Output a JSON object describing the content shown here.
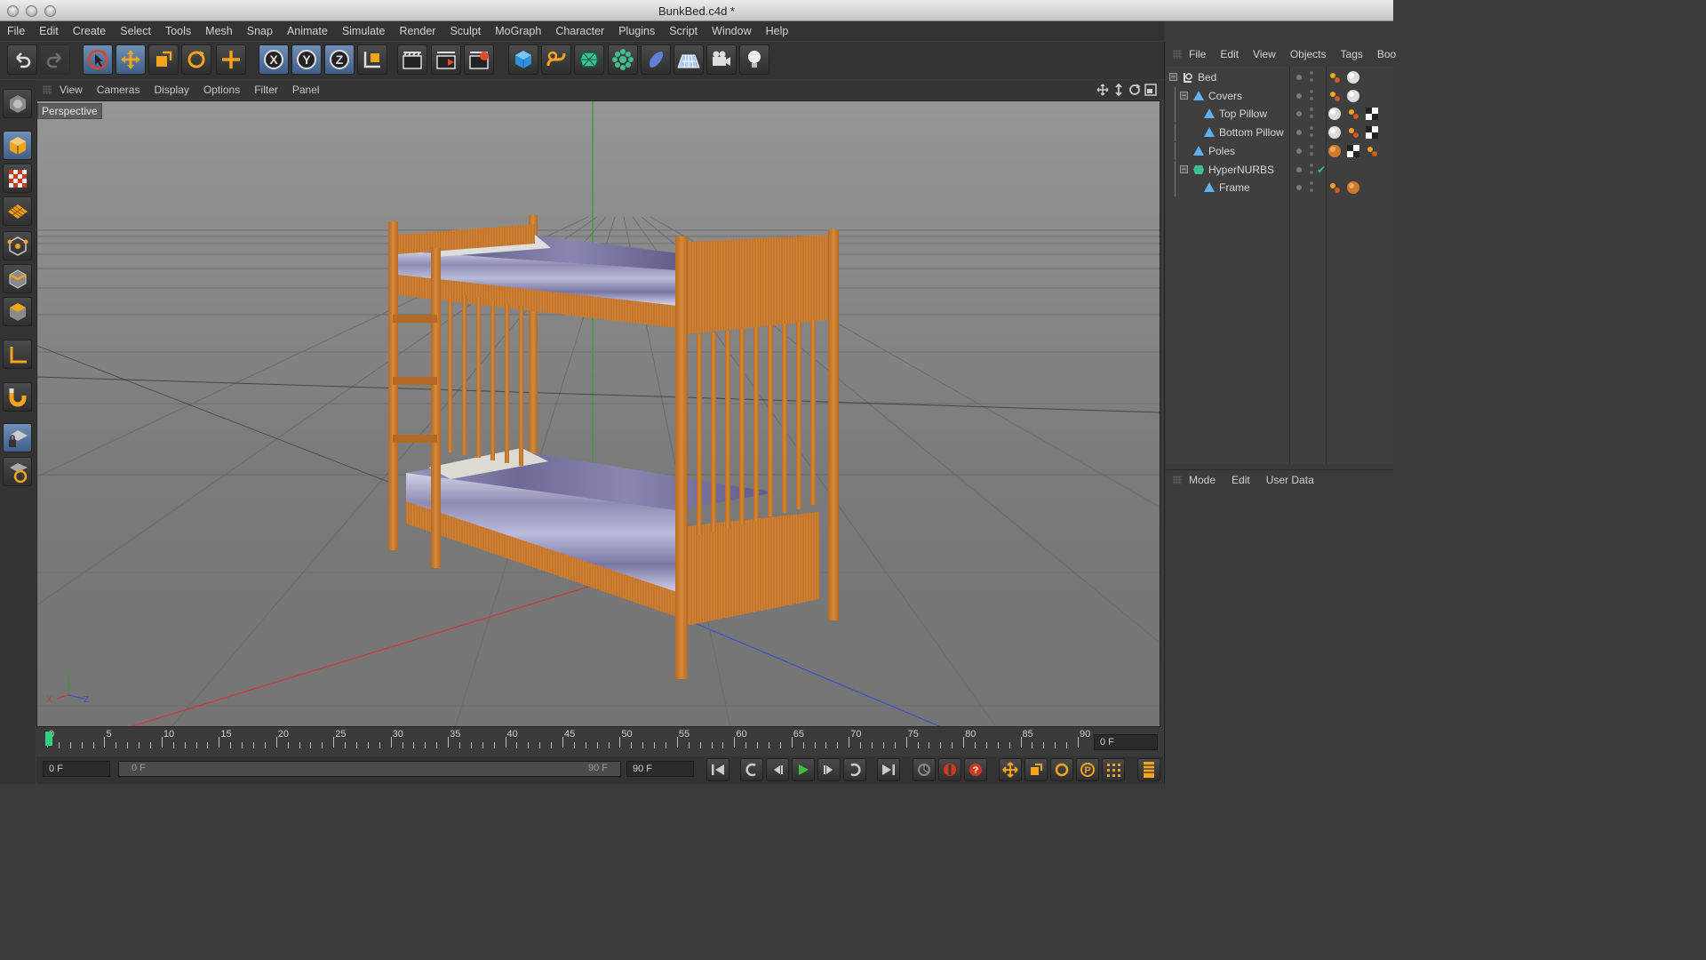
{
  "window": {
    "title": "BunkBed.c4d *"
  },
  "menubar": [
    "File",
    "Edit",
    "Create",
    "Select",
    "Tools",
    "Mesh",
    "Snap",
    "Animate",
    "Simulate",
    "Render",
    "Sculpt",
    "MoGraph",
    "Character",
    "Plugins",
    "Script",
    "Window",
    "Help"
  ],
  "toolbar": {
    "buttons": [
      "undo-icon",
      "redo-icon",
      "live-selection-icon",
      "move-icon",
      "scale-icon",
      "rotate-icon",
      "add-icon",
      "x-axis-icon",
      "y-axis-icon",
      "z-axis-icon",
      "coordinate-system-icon",
      "render-view-icon",
      "render-picture-viewer-icon",
      "edit-render-settings-icon",
      "cube-primitive-icon",
      "spline-icon",
      "nurbs-icon",
      "array-icon",
      "deformer-icon",
      "floor-icon",
      "camera-icon",
      "light-icon"
    ]
  },
  "left_toolbar": [
    "make-editable-icon",
    "model-mode-icon",
    "texture-mode-icon",
    "workplane-mode-icon",
    "points-mode-icon",
    "edges-mode-icon",
    "polygons-mode-icon",
    "axis-mode-icon",
    "magnet-icon",
    "locked-workplane-icon",
    "soft-selection-icon"
  ],
  "viewport": {
    "menu": [
      "View",
      "Cameras",
      "Display",
      "Options",
      "Filter",
      "Panel"
    ],
    "label": "Perspective",
    "nav_icons": [
      "pan-icon",
      "zoom-icon",
      "orbit-icon",
      "maximize-icon"
    ],
    "axis_gizmo": {
      "x": "X",
      "y": "Y",
      "z": "Z"
    }
  },
  "object_manager": {
    "menu": [
      "File",
      "Edit",
      "View",
      "Objects",
      "Tags",
      "Boo"
    ],
    "objects": [
      {
        "name": "Bed",
        "type": "null-icon",
        "depth": 0,
        "expanded": true,
        "tags": [
          "material-tag-icon",
          "phong-tag-icon"
        ]
      },
      {
        "name": "Covers",
        "type": "polygon-icon",
        "depth": 1,
        "expanded": true,
        "tags": [
          "material-tag-icon",
          "phong-tag-icon"
        ]
      },
      {
        "name": "Top Pillow",
        "type": "polygon-icon",
        "depth": 2,
        "tags": [
          "phong-tag-icon",
          "material-tag-icon",
          "texture-tag-icon"
        ]
      },
      {
        "name": "Bottom Pillow",
        "type": "polygon-icon",
        "depth": 2,
        "tags": [
          "phong-tag-icon",
          "material-tag-icon",
          "texture-tag-icon"
        ]
      },
      {
        "name": "Poles",
        "type": "polygon-icon",
        "depth": 1,
        "tags": [
          "wood-material-tag-icon",
          "texture-tag-icon",
          "material-tag-icon"
        ]
      },
      {
        "name": "HyperNURBS",
        "type": "hypernurbs-icon",
        "depth": 1,
        "expanded": true,
        "enabled_check": "✔",
        "tags": []
      },
      {
        "name": "Frame",
        "type": "polygon-icon",
        "depth": 2,
        "tags": [
          "material-tag-icon",
          "wood-material-tag-icon"
        ]
      }
    ]
  },
  "attribute_manager": {
    "menu": [
      "Mode",
      "Edit",
      "User Data"
    ]
  },
  "timeline": {
    "ticks": [
      "0",
      "5",
      "10",
      "15",
      "20",
      "25",
      "30",
      "35",
      "40",
      "45",
      "50",
      "55",
      "60",
      "65",
      "70",
      "75",
      "80",
      "85",
      "90"
    ],
    "current_frame_display": "0 F"
  },
  "transport": {
    "start_field": "0 F",
    "range_start": "0 F",
    "range_end": "90 F",
    "end_field": "90 F",
    "buttons": [
      "go-to-start-icon",
      "previous-key-icon",
      "previous-frame-icon",
      "play-icon",
      "next-frame-icon",
      "next-key-icon",
      "go-to-end-icon",
      "autokey-icon",
      "record-icon",
      "keyframe-selection-icon",
      "position-key-icon",
      "scale-key-icon",
      "rotation-key-icon",
      "parameter-key-icon",
      "point-level-icon",
      "timeline-icon"
    ]
  },
  "colors": {
    "accent": "#6f8fb8",
    "play": "#3fbf3f",
    "x_axis": "#c83a3a",
    "y_axis": "#2ea02e",
    "z_axis": "#3a4fc8",
    "wood": "#c8782c"
  }
}
